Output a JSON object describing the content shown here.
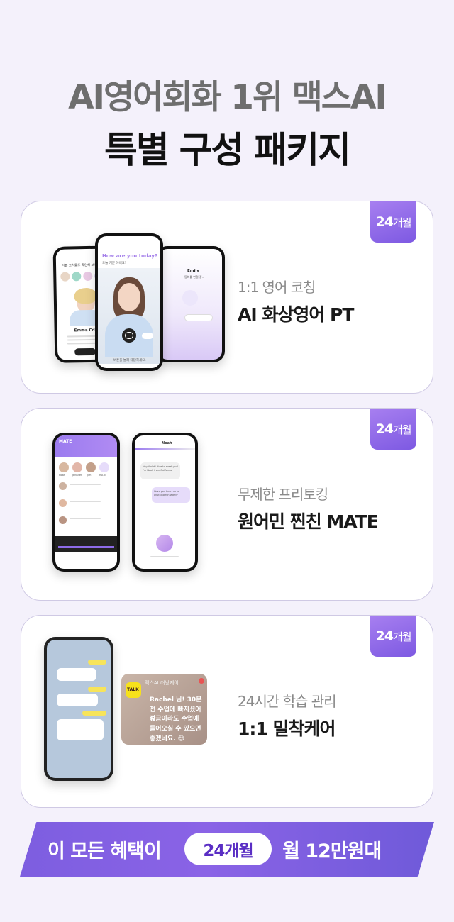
{
  "header": {
    "line1": "AI영어회화 1위 맥스AI",
    "line2": "특별 구성 패키지"
  },
  "packages": [
    {
      "badge_num": "24",
      "badge_unit": "개월",
      "subtitle": "1:1 영어 코칭",
      "title": "AI 화상영어 PT",
      "mockup": {
        "left_header": "다른 코치들도 확인해 보세요",
        "left_name": "Emma Cole",
        "center_title": "How are you today?",
        "center_sub": "오늘 기분 어때요?",
        "center_caption": "버튼을 눌러 대답하세요.",
        "right_name": "Emily",
        "right_sub": "통화를 연결 중..."
      }
    },
    {
      "badge_num": "24",
      "badge_unit": "개월",
      "subtitle": "무제한 프리토킹",
      "title": "원어민 찐친 MATE",
      "mockup": {
        "app_title": "MATE",
        "friends": [
          "Noah",
          "Jennifer",
          "Jim",
          "MATE"
        ],
        "chat_name": "Noah",
        "bubble1": "Hey Violet! Nice to meet you! I'm Noah from California.",
        "bubble2": "Have you been up to anything fun lately?"
      }
    },
    {
      "badge_num": "24",
      "badge_unit": "개월",
      "subtitle": "24시간 학습 관리",
      "title": "1:1 밀착케어",
      "kakao": {
        "label": "TALK",
        "header": "맥스AI 러닝케어",
        "message1": "Rachel 님! 30분 전 수업에 빠지셨어요.",
        "message2": "지금이라도 수업에 들어오실 수 있으면 좋겠네요. 😊"
      }
    }
  ],
  "banner": {
    "left": "이 모든 혜택이",
    "pill": "24개월",
    "right": "월 12만원대"
  },
  "colors": {
    "accent": "#7d59e2",
    "badge_start": "#a77ff0",
    "pill_text": "#5a2ec4",
    "kakao_yellow": "#f7e11b"
  }
}
